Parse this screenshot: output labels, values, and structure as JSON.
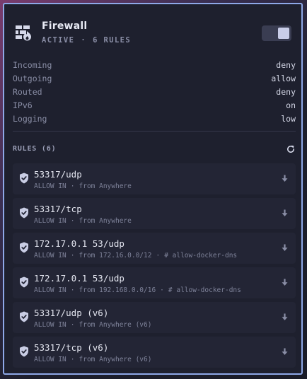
{
  "panel": {
    "title": "Firewall",
    "status": "ACTIVE",
    "rules_count": "6 RULES",
    "enabled": true
  },
  "settings": [
    {
      "key": "Incoming",
      "value": "deny"
    },
    {
      "key": "Outgoing",
      "value": "allow"
    },
    {
      "key": "Routed",
      "value": "deny"
    },
    {
      "key": "IPv6",
      "value": "on"
    },
    {
      "key": "Logging",
      "value": "low"
    }
  ],
  "rules_header": "RULES (6)",
  "rules": [
    {
      "target": "53317/udp",
      "action": "ALLOW IN",
      "from": "from Anywhere",
      "comment": ""
    },
    {
      "target": "53317/tcp",
      "action": "ALLOW IN",
      "from": "from Anywhere",
      "comment": ""
    },
    {
      "target": "172.17.0.1 53/udp",
      "action": "ALLOW IN",
      "from": "from 172.16.0.0/12",
      "comment": "# allow-docker-dns"
    },
    {
      "target": "172.17.0.1 53/udp",
      "action": "ALLOW IN",
      "from": "from 192.168.0.0/16",
      "comment": "# allow-docker-dns"
    },
    {
      "target": "53317/udp (v6)",
      "action": "ALLOW IN",
      "from": "from Anywhere (v6)",
      "comment": ""
    },
    {
      "target": "53317/tcp (v6)",
      "action": "ALLOW IN",
      "from": "from Anywhere (v6)",
      "comment": ""
    }
  ],
  "icons": {
    "header": "firewall-icon",
    "toggle": "toggle-switch",
    "refresh": "refresh-icon",
    "rule": "shield-check-icon",
    "action": "arrow-down-icon"
  },
  "colors": {
    "accent_border": "#8ea8e8",
    "panel_bg": "#1e202e",
    "row_bg": "#232535"
  }
}
